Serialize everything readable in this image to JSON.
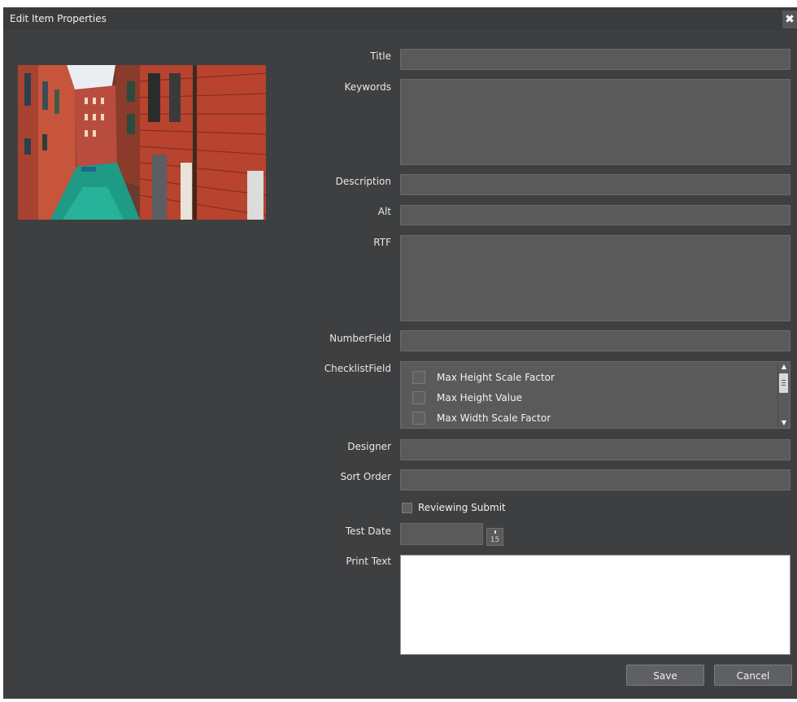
{
  "dialog": {
    "title": "Edit Item Properties",
    "close_icon": "close-icon"
  },
  "form": {
    "labels": {
      "title": "Title",
      "keywords": "Keywords",
      "description": "Description",
      "alt": "Alt",
      "rtf": "RTF",
      "number_field": "NumberField",
      "checklist_field": "ChecklistField",
      "designer": "Designer",
      "sort_order": "Sort Order",
      "test_date": "Test Date",
      "print_text": "Print Text"
    },
    "checklist": {
      "items": [
        {
          "label": "Max Height Scale Factor",
          "checked": false
        },
        {
          "label": "Max Height Value",
          "checked": false
        },
        {
          "label": "Max Width Scale Factor",
          "checked": false
        }
      ]
    },
    "reviewing_submit": {
      "label": "Reviewing Submit",
      "checked": false
    },
    "calendar_icon_day": "15"
  },
  "buttons": {
    "save": "Save",
    "cancel": "Cancel"
  },
  "colors": {
    "dialog_bg": "#3e3f41",
    "field_bg": "#5a5a5a",
    "button_bg": "#5f6062"
  }
}
